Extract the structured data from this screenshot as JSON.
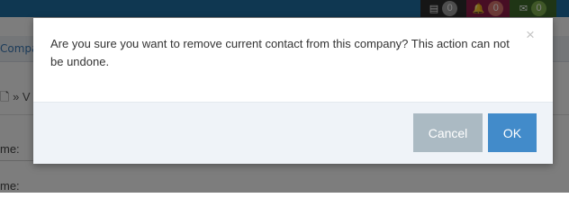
{
  "background": {
    "nav": {
      "messages": {
        "icon": "tasks-icon",
        "glyph": "▤",
        "count": "0",
        "color": "#2c2c2c"
      },
      "alerts": {
        "icon": "bell-icon",
        "glyph": "🔔",
        "count": "0",
        "color": "#8e1c48"
      },
      "mail": {
        "icon": "envelope-icon",
        "glyph": "✉",
        "count": "0",
        "color": "#3e6b2a"
      }
    },
    "breadcrumb": "Compa",
    "subnav": "🗋  » V",
    "labels": [
      "me:",
      "me:"
    ]
  },
  "modal": {
    "message": "Are you sure you want to remove current contact from this company? This action can not be undone.",
    "close_glyph": "×",
    "cancel_label": "Cancel",
    "ok_label": "OK"
  },
  "colors": {
    "topbar": "#1f6fa3",
    "cancel_button": "#abbac3",
    "ok_button": "#428bca",
    "footer": "#eff3f8"
  }
}
